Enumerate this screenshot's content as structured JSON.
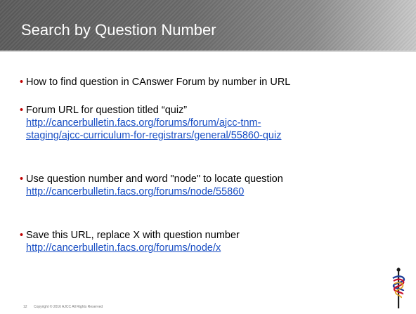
{
  "header": {
    "title": "Search by Question Number"
  },
  "bullets": [
    {
      "text": "How to find question in CAnswer Forum by number in URL"
    },
    {
      "text": "Forum URL for question titled “quiz”",
      "link_lines": [
        "http://cancerbulletin.facs.org/forums/forum/ajcc-tnm-",
        "staging/ajcc-curriculum-for-registrars/general/55860-quiz"
      ]
    },
    {
      "text": "Use question number and word \"node\" to locate question",
      "link_lines": [
        "http://cancerbulletin.facs.org/forums/node/55860"
      ]
    },
    {
      "text": "Save this URL, replace X with question number",
      "link_lines": [
        "http://cancerbulletin.facs.org/forums/node/x"
      ]
    }
  ],
  "footer": {
    "page_number": "12",
    "copyright": "Copyright © 2016  AJCC  All Rights Reserved"
  },
  "colors": {
    "bullet": "#c00000",
    "link": "#1a4fc4",
    "logo_red": "#c8102e",
    "logo_blue": "#1f3f99",
    "logo_gold": "#e2a325"
  },
  "logo": {
    "icon": "ajcc-logo-icon"
  }
}
